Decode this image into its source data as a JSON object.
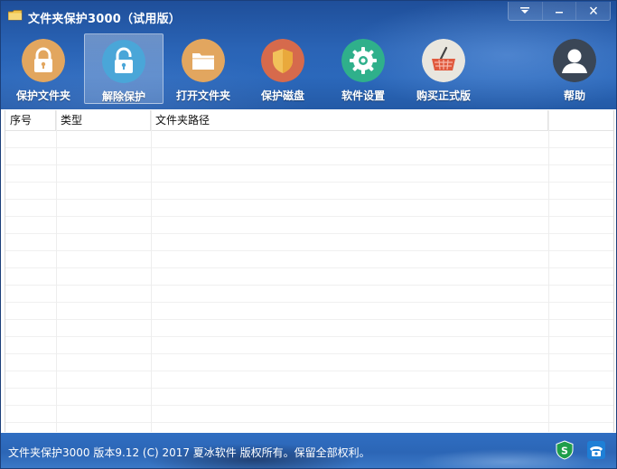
{
  "window": {
    "title": "文件夹保护3000（试用版）",
    "controls": [
      "menu",
      "minimize",
      "close"
    ]
  },
  "toolbar": {
    "items": [
      {
        "label": "保护文件夹",
        "icon": "lock-closed-icon",
        "color": "#e2a65f"
      },
      {
        "label": "解除保护",
        "icon": "lock-open-icon",
        "color": "#4aa6d8",
        "active": true
      },
      {
        "label": "打开文件夹",
        "icon": "folder-icon",
        "color": "#e2a65f"
      },
      {
        "label": "保护磁盘",
        "icon": "shield-icon",
        "color": "#d66a4c"
      },
      {
        "label": "软件设置",
        "icon": "gear-icon",
        "color": "#2fb08b"
      },
      {
        "label": "购买正式版",
        "icon": "basket-icon",
        "color": "#e9e6de"
      },
      {
        "label": "帮助",
        "icon": "user-help-icon",
        "color": "#3a4656"
      }
    ]
  },
  "table": {
    "columns": [
      "序号",
      "类型",
      "文件夹路径"
    ],
    "rows": []
  },
  "status": {
    "text": "文件夹保护3000 版本9.12 (C) 2017 夏冰软件 版权所有。保留全部权利。",
    "icons": [
      "security-s-icon",
      "phone-icon"
    ]
  },
  "colors": {
    "header": "#2a64b6",
    "status": "#2f6ec2",
    "active_tool_highlight": "#ffffff"
  }
}
